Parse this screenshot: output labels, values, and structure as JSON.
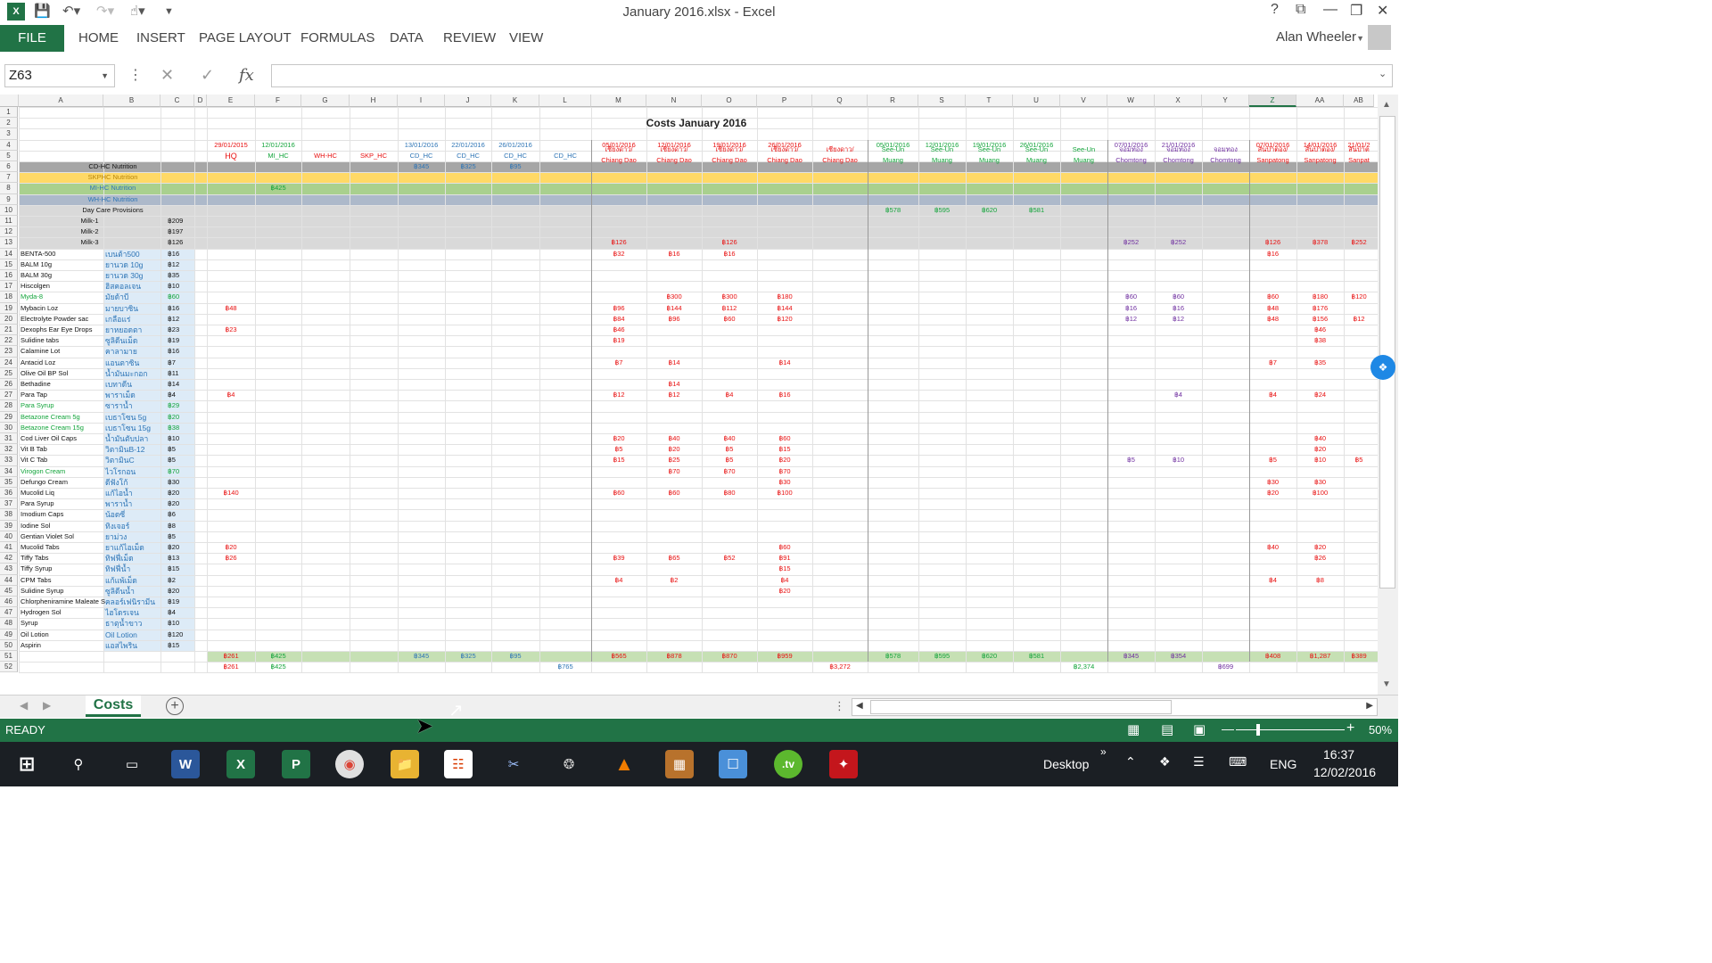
{
  "window": {
    "title": "January 2016.xlsx - Excel"
  },
  "ribbon": {
    "file": "FILE",
    "tabs": [
      "HOME",
      "INSERT",
      "PAGE LAYOUT",
      "FORMULAS",
      "DATA",
      "REVIEW",
      "VIEW"
    ],
    "user": "Alan Wheeler"
  },
  "formula_bar": {
    "name_box": "Z63",
    "fx": "fx",
    "value": ""
  },
  "columns": [
    "A",
    "B",
    "C",
    "D",
    "E",
    "F",
    "G",
    "H",
    "I",
    "J",
    "K",
    "L",
    "M",
    "N",
    "O",
    "P",
    "Q",
    "R",
    "S",
    "T",
    "U",
    "V",
    "W",
    "X",
    "Y",
    "Z",
    "AA",
    "AB"
  ],
  "sheet": {
    "title": "Costs January 2016",
    "header_dates": [
      "29/01/2015",
      "12/01/2016",
      "",
      "",
      "13/01/2016",
      "22/01/2016",
      "26/01/2016",
      "",
      "05/01/2016",
      "12/01/2016",
      "19/01/2016",
      "26/01/2016",
      "",
      "05/01/2016",
      "12/01/2016",
      "19/01/2016",
      "26/01/2016",
      "",
      "07/01/2016",
      "21/01/2016",
      "",
      "07/01/2016",
      "14/01/2016",
      "21/01/2"
    ],
    "header_loc1": [
      "HQ",
      "MI_HC",
      "WH-HC",
      "SKP_HC",
      "CD_HC",
      "CD_HC",
      "CD_HC",
      "CD_HC",
      "เชียงดาว/",
      "เชียงดาว/",
      "เชียงดาว/",
      "เชียงดาว/",
      "เชียงดาว/",
      "See-Un",
      "See-Un",
      "See-Un",
      "See-Un",
      "See-Un",
      "จอมทอง",
      "จอมทอง",
      "จอมทอง",
      "สันป่าตอง/",
      "สันป่าตอง/",
      "สันป่าต"
    ],
    "header_loc2": [
      "",
      "",
      "",
      "",
      "",
      "",
      "",
      "",
      "Chiang Dao",
      "Chiang Dao",
      "Chiang Dao",
      "Chiang Dao",
      "Chiang Dao",
      "Muang",
      "Muang",
      "Muang",
      "Muang",
      "Muang",
      "Chomtong",
      "Chomtong",
      "Chomtong",
      "Sanpatong",
      "Sanpatong",
      "Sanpat"
    ],
    "band_rows": [
      {
        "row": 6,
        "label": "CD-HC Nutrition"
      },
      {
        "row": 7,
        "label": "SKPHC Nutrition"
      },
      {
        "row": 8,
        "label": "MI-HC Nutrition"
      },
      {
        "row": 9,
        "label": "WH-HC Nutrition"
      },
      {
        "row": 10,
        "label": "Day Care Provisions"
      }
    ],
    "milk_rows": [
      {
        "row": 11,
        "label": "Milk-1",
        "price": "฿209"
      },
      {
        "row": 12,
        "label": "Milk-2",
        "price": "฿197"
      },
      {
        "row": 13,
        "label": "Milk-3",
        "price": "฿126"
      }
    ],
    "items": [
      {
        "en": "BENTA-500",
        "th": "เบนต้า500",
        "p": "฿16"
      },
      {
        "en": "BALM 10g",
        "th": "ยานวด 10g",
        "p": "฿12"
      },
      {
        "en": "BALM 30g",
        "th": "ยานวด 30g",
        "p": "฿35"
      },
      {
        "en": "Hiscolgen",
        "th": "ฮิสคอลเจน",
        "p": "฿10"
      },
      {
        "en": "Myda-8",
        "th": "มัยด้าบี",
        "p": "฿60"
      },
      {
        "en": "Mybacin Loz",
        "th": "มายบาซิน",
        "p": "฿16"
      },
      {
        "en": "Electrolyte Powder sac",
        "th": "เกลือแร่",
        "p": "฿12"
      },
      {
        "en": "Dexophs Ear Eye Drops",
        "th": "ยาหยอดตา",
        "p": "฿23"
      },
      {
        "en": "Sulidine tabs",
        "th": "ซูลิดีนเม็ด",
        "p": "฿19"
      },
      {
        "en": "Calamine Lot",
        "th": "คาลามาย",
        "p": "฿16"
      },
      {
        "en": "Antacid Loz",
        "th": "แอนตาซิน",
        "p": "฿7"
      },
      {
        "en": "Olive Oil BP Sol",
        "th": "น้ำมันมะกอก",
        "p": "฿11"
      },
      {
        "en": "Bethadine",
        "th": "เบทาดีน",
        "p": "฿14"
      },
      {
        "en": "Para Tap",
        "th": "พาราเม็ด",
        "p": "฿4"
      },
      {
        "en": "Para Syrup",
        "th": "ซาราน้ำ",
        "p": "฿29"
      },
      {
        "en": "Betazone Cream 5g",
        "th": "เบธาโซน 5g",
        "p": "฿20"
      },
      {
        "en": "Betazone Cream 15g",
        "th": "เบธาโซน 15g",
        "p": "฿38"
      },
      {
        "en": "Cod Liver Oil Caps",
        "th": "น้ำมันตับปลา",
        "p": "฿10"
      },
      {
        "en": "Vit B Tab",
        "th": "วิตามินB-12",
        "p": "฿5"
      },
      {
        "en": "Vit C Tab",
        "th": "วิตามินC",
        "p": "฿5"
      },
      {
        "en": "Virogon Cream",
        "th": "ไวโรกอน",
        "p": "฿70"
      },
      {
        "en": "Defungo Cream",
        "th": "ดีฟังโก้",
        "p": "฿30"
      },
      {
        "en": "Mucolid Liq",
        "th": "แก้ไอน้ำ",
        "p": "฿20"
      },
      {
        "en": "Para Syrup",
        "th": "พาราน้ำ",
        "p": "฿20"
      },
      {
        "en": "Imodium Caps",
        "th": "น้อดซี่",
        "p": "฿6"
      },
      {
        "en": "Iodine Sol",
        "th": "ทิงเจอร์",
        "p": "฿8"
      },
      {
        "en": "Gentian Violet Sol",
        "th": "ยาม่วง",
        "p": "฿5"
      },
      {
        "en": "Mucolid Tabs",
        "th": "ยาแก้ไอเม็ด",
        "p": "฿20"
      },
      {
        "en": "Tiffy Tabs",
        "th": "ทิฟฟี่เม็ด",
        "p": "฿13"
      },
      {
        "en": "Tiffy Syrup",
        "th": "ทิฟฟี่น้ำ",
        "p": "฿15"
      },
      {
        "en": "CPM Tabs",
        "th": "แก้แพ้เม็ด",
        "p": "฿2"
      },
      {
        "en": "Sulidine Syrup",
        "th": "ซูลิดีนน้ำ",
        "p": "฿20"
      },
      {
        "en": "Chlorpheniramine Maleate S",
        "th": "คลอร์เฟนิรามีน",
        "p": "฿19"
      },
      {
        "en": "Hydrogen Sol",
        "th": "ไฮโดรเจน",
        "p": "฿4"
      },
      {
        "en": "Syrup",
        "th": "ธาตุน้ำขาว",
        "p": "฿10"
      },
      {
        "en": "Oil Lotion",
        "th": "Oil Lotion",
        "p": "฿120"
      },
      {
        "en": "Aspirin",
        "th": "แอสไพริน",
        "p": "฿15"
      }
    ],
    "values": [
      {
        "r": 6,
        "c": "I",
        "v": "฿345",
        "k": "b"
      },
      {
        "r": 6,
        "c": "J",
        "v": "฿325",
        "k": "b"
      },
      {
        "r": 6,
        "c": "K",
        "v": "฿95",
        "k": "b"
      },
      {
        "r": 8,
        "c": "F",
        "v": "฿425",
        "k": "g"
      },
      {
        "r": 10,
        "c": "R",
        "v": "฿578",
        "k": "g"
      },
      {
        "r": 10,
        "c": "S",
        "v": "฿595",
        "k": "g"
      },
      {
        "r": 10,
        "c": "T",
        "v": "฿620",
        "k": "g"
      },
      {
        "r": 10,
        "c": "U",
        "v": "฿581",
        "k": "g"
      },
      {
        "r": 13,
        "c": "M",
        "v": "฿126",
        "k": "r"
      },
      {
        "r": 13,
        "c": "O",
        "v": "฿126",
        "k": "r"
      },
      {
        "r": 13,
        "c": "W",
        "v": "฿252",
        "k": "p"
      },
      {
        "r": 13,
        "c": "X",
        "v": "฿252",
        "k": "p"
      },
      {
        "r": 13,
        "c": "Z",
        "v": "฿126",
        "k": "r"
      },
      {
        "r": 13,
        "c": "AA",
        "v": "฿378",
        "k": "r"
      },
      {
        "r": 13,
        "c": "AB",
        "v": "฿252",
        "k": "r"
      },
      {
        "r": 14,
        "c": "M",
        "v": "฿32",
        "k": "r"
      },
      {
        "r": 14,
        "c": "N",
        "v": "฿16",
        "k": "r"
      },
      {
        "r": 14,
        "c": "O",
        "v": "฿16",
        "k": "r"
      },
      {
        "r": 14,
        "c": "Z",
        "v": "฿16",
        "k": "r"
      },
      {
        "r": 18,
        "c": "N",
        "v": "฿300",
        "k": "r"
      },
      {
        "r": 18,
        "c": "O",
        "v": "฿300",
        "k": "r"
      },
      {
        "r": 18,
        "c": "P",
        "v": "฿180",
        "k": "r"
      },
      {
        "r": 18,
        "c": "W",
        "v": "฿60",
        "k": "p"
      },
      {
        "r": 18,
        "c": "X",
        "v": "฿60",
        "k": "p"
      },
      {
        "r": 18,
        "c": "Z",
        "v": "฿60",
        "k": "r"
      },
      {
        "r": 18,
        "c": "AA",
        "v": "฿180",
        "k": "r"
      },
      {
        "r": 18,
        "c": "AB",
        "v": "฿120",
        "k": "r"
      },
      {
        "r": 19,
        "c": "E",
        "v": "฿48",
        "k": "r"
      },
      {
        "r": 19,
        "c": "M",
        "v": "฿96",
        "k": "r"
      },
      {
        "r": 19,
        "c": "N",
        "v": "฿144",
        "k": "r"
      },
      {
        "r": 19,
        "c": "O",
        "v": "฿112",
        "k": "r"
      },
      {
        "r": 19,
        "c": "P",
        "v": "฿144",
        "k": "r"
      },
      {
        "r": 19,
        "c": "W",
        "v": "฿16",
        "k": "p"
      },
      {
        "r": 19,
        "c": "X",
        "v": "฿16",
        "k": "p"
      },
      {
        "r": 19,
        "c": "Z",
        "v": "฿48",
        "k": "r"
      },
      {
        "r": 19,
        "c": "AA",
        "v": "฿176",
        "k": "r"
      },
      {
        "r": 20,
        "c": "M",
        "v": "฿84",
        "k": "r"
      },
      {
        "r": 20,
        "c": "N",
        "v": "฿96",
        "k": "r"
      },
      {
        "r": 20,
        "c": "O",
        "v": "฿60",
        "k": "r"
      },
      {
        "r": 20,
        "c": "P",
        "v": "฿120",
        "k": "r"
      },
      {
        "r": 20,
        "c": "W",
        "v": "฿12",
        "k": "p"
      },
      {
        "r": 20,
        "c": "X",
        "v": "฿12",
        "k": "p"
      },
      {
        "r": 20,
        "c": "Z",
        "v": "฿48",
        "k": "r"
      },
      {
        "r": 20,
        "c": "AA",
        "v": "฿156",
        "k": "r"
      },
      {
        "r": 20,
        "c": "AB",
        "v": "฿12",
        "k": "r"
      },
      {
        "r": 21,
        "c": "E",
        "v": "฿23",
        "k": "r"
      },
      {
        "r": 21,
        "c": "M",
        "v": "฿46",
        "k": "r"
      },
      {
        "r": 21,
        "c": "AA",
        "v": "฿46",
        "k": "r"
      },
      {
        "r": 22,
        "c": "M",
        "v": "฿19",
        "k": "r"
      },
      {
        "r": 22,
        "c": "AA",
        "v": "฿38",
        "k": "r"
      },
      {
        "r": 24,
        "c": "M",
        "v": "฿7",
        "k": "r"
      },
      {
        "r": 24,
        "c": "N",
        "v": "฿14",
        "k": "r"
      },
      {
        "r": 24,
        "c": "P",
        "v": "฿14",
        "k": "r"
      },
      {
        "r": 24,
        "c": "Z",
        "v": "฿7",
        "k": "r"
      },
      {
        "r": 24,
        "c": "AA",
        "v": "฿35",
        "k": "r"
      },
      {
        "r": 26,
        "c": "N",
        "v": "฿14",
        "k": "r"
      },
      {
        "r": 27,
        "c": "E",
        "v": "฿4",
        "k": "r"
      },
      {
        "r": 27,
        "c": "M",
        "v": "฿12",
        "k": "r"
      },
      {
        "r": 27,
        "c": "N",
        "v": "฿12",
        "k": "r"
      },
      {
        "r": 27,
        "c": "O",
        "v": "฿4",
        "k": "r"
      },
      {
        "r": 27,
        "c": "P",
        "v": "฿16",
        "k": "r"
      },
      {
        "r": 27,
        "c": "X",
        "v": "฿4",
        "k": "p"
      },
      {
        "r": 27,
        "c": "Z",
        "v": "฿4",
        "k": "r"
      },
      {
        "r": 27,
        "c": "AA",
        "v": "฿24",
        "k": "r"
      },
      {
        "r": 31,
        "c": "M",
        "v": "฿20",
        "k": "r"
      },
      {
        "r": 31,
        "c": "N",
        "v": "฿40",
        "k": "r"
      },
      {
        "r": 31,
        "c": "O",
        "v": "฿40",
        "k": "r"
      },
      {
        "r": 31,
        "c": "P",
        "v": "฿60",
        "k": "r"
      },
      {
        "r": 31,
        "c": "AA",
        "v": "฿40",
        "k": "r"
      },
      {
        "r": 32,
        "c": "M",
        "v": "฿5",
        "k": "r"
      },
      {
        "r": 32,
        "c": "N",
        "v": "฿20",
        "k": "r"
      },
      {
        "r": 32,
        "c": "O",
        "v": "฿5",
        "k": "r"
      },
      {
        "r": 32,
        "c": "P",
        "v": "฿15",
        "k": "r"
      },
      {
        "r": 32,
        "c": "AA",
        "v": "฿20",
        "k": "r"
      },
      {
        "r": 33,
        "c": "M",
        "v": "฿15",
        "k": "r"
      },
      {
        "r": 33,
        "c": "N",
        "v": "฿25",
        "k": "r"
      },
      {
        "r": 33,
        "c": "O",
        "v": "฿5",
        "k": "r"
      },
      {
        "r": 33,
        "c": "P",
        "v": "฿20",
        "k": "r"
      },
      {
        "r": 33,
        "c": "W",
        "v": "฿5",
        "k": "p"
      },
      {
        "r": 33,
        "c": "X",
        "v": "฿10",
        "k": "p"
      },
      {
        "r": 33,
        "c": "Z",
        "v": "฿5",
        "k": "r"
      },
      {
        "r": 33,
        "c": "AA",
        "v": "฿10",
        "k": "r"
      },
      {
        "r": 33,
        "c": "AB",
        "v": "฿5",
        "k": "r"
      },
      {
        "r": 34,
        "c": "N",
        "v": "฿70",
        "k": "r"
      },
      {
        "r": 34,
        "c": "O",
        "v": "฿70",
        "k": "r"
      },
      {
        "r": 34,
        "c": "P",
        "v": "฿70",
        "k": "r"
      },
      {
        "r": 35,
        "c": "P",
        "v": "฿30",
        "k": "r"
      },
      {
        "r": 35,
        "c": "Z",
        "v": "฿30",
        "k": "r"
      },
      {
        "r": 35,
        "c": "AA",
        "v": "฿30",
        "k": "r"
      },
      {
        "r": 36,
        "c": "E",
        "v": "฿140",
        "k": "r"
      },
      {
        "r": 36,
        "c": "M",
        "v": "฿60",
        "k": "r"
      },
      {
        "r": 36,
        "c": "N",
        "v": "฿60",
        "k": "r"
      },
      {
        "r": 36,
        "c": "O",
        "v": "฿80",
        "k": "r"
      },
      {
        "r": 36,
        "c": "P",
        "v": "฿100",
        "k": "r"
      },
      {
        "r": 36,
        "c": "Z",
        "v": "฿20",
        "k": "r"
      },
      {
        "r": 36,
        "c": "AA",
        "v": "฿100",
        "k": "r"
      },
      {
        "r": 41,
        "c": "E",
        "v": "฿20",
        "k": "r"
      },
      {
        "r": 41,
        "c": "P",
        "v": "฿60",
        "k": "r"
      },
      {
        "r": 41,
        "c": "Z",
        "v": "฿40",
        "k": "r"
      },
      {
        "r": 41,
        "c": "AA",
        "v": "฿20",
        "k": "r"
      },
      {
        "r": 42,
        "c": "E",
        "v": "฿26",
        "k": "r"
      },
      {
        "r": 42,
        "c": "M",
        "v": "฿39",
        "k": "r"
      },
      {
        "r": 42,
        "c": "N",
        "v": "฿65",
        "k": "r"
      },
      {
        "r": 42,
        "c": "O",
        "v": "฿52",
        "k": "r"
      },
      {
        "r": 42,
        "c": "P",
        "v": "฿91",
        "k": "r"
      },
      {
        "r": 42,
        "c": "AA",
        "v": "฿26",
        "k": "r"
      },
      {
        "r": 43,
        "c": "P",
        "v": "฿15",
        "k": "r"
      },
      {
        "r": 44,
        "c": "M",
        "v": "฿4",
        "k": "r"
      },
      {
        "r": 44,
        "c": "N",
        "v": "฿2",
        "k": "r"
      },
      {
        "r": 44,
        "c": "P",
        "v": "฿4",
        "k": "r"
      },
      {
        "r": 44,
        "c": "Z",
        "v": "฿4",
        "k": "r"
      },
      {
        "r": 44,
        "c": "AA",
        "v": "฿8",
        "k": "r"
      },
      {
        "r": 45,
        "c": "P",
        "v": "฿20",
        "k": "r"
      },
      {
        "r": 51,
        "c": "E",
        "v": "฿261",
        "k": "r"
      },
      {
        "r": 51,
        "c": "F",
        "v": "฿425",
        "k": "g"
      },
      {
        "r": 51,
        "c": "I",
        "v": "฿345",
        "k": "b"
      },
      {
        "r": 51,
        "c": "J",
        "v": "฿325",
        "k": "b"
      },
      {
        "r": 51,
        "c": "K",
        "v": "฿95",
        "k": "b"
      },
      {
        "r": 51,
        "c": "M",
        "v": "฿565",
        "k": "r"
      },
      {
        "r": 51,
        "c": "N",
        "v": "฿878",
        "k": "r"
      },
      {
        "r": 51,
        "c": "O",
        "v": "฿870",
        "k": "r"
      },
      {
        "r": 51,
        "c": "P",
        "v": "฿959",
        "k": "r"
      },
      {
        "r": 51,
        "c": "R",
        "v": "฿578",
        "k": "g"
      },
      {
        "r": 51,
        "c": "S",
        "v": "฿595",
        "k": "g"
      },
      {
        "r": 51,
        "c": "T",
        "v": "฿620",
        "k": "g"
      },
      {
        "r": 51,
        "c": "U",
        "v": "฿581",
        "k": "g"
      },
      {
        "r": 51,
        "c": "W",
        "v": "฿345",
        "k": "p"
      },
      {
        "r": 51,
        "c": "X",
        "v": "฿354",
        "k": "p"
      },
      {
        "r": 51,
        "c": "Z",
        "v": "฿408",
        "k": "r"
      },
      {
        "r": 51,
        "c": "AA",
        "v": "฿1,287",
        "k": "r"
      },
      {
        "r": 51,
        "c": "AB",
        "v": "฿389",
        "k": "r"
      },
      {
        "r": 52,
        "c": "E",
        "v": "฿261",
        "k": "r"
      },
      {
        "r": 52,
        "c": "F",
        "v": "฿425",
        "k": "g"
      },
      {
        "r": 52,
        "c": "L",
        "v": "฿765",
        "k": "b"
      },
      {
        "r": 52,
        "c": "Q",
        "v": "฿3,272",
        "k": "r"
      },
      {
        "r": 52,
        "c": "V",
        "v": "฿2,374",
        "k": "g"
      },
      {
        "r": 52,
        "c": "Y",
        "v": "฿699",
        "k": "p"
      }
    ],
    "colors": {
      "r": "#e81010",
      "g": "#12a43a",
      "b": "#2e75b6",
      "p": "#7030a0",
      "band_cd": "#a6a6a6",
      "band_skp": "#ffd966",
      "band_mi": "#a9d08e",
      "band_wh": "#adb9ca",
      "band_day": "#d9d9d9",
      "thai_bg": "#ddebf7",
      "total_bg": "#c6e0b4"
    }
  },
  "sheet_tabs": {
    "active": "Costs"
  },
  "status": {
    "ready": "READY",
    "zoom": "50%"
  },
  "taskbar": {
    "desktop": "Desktop",
    "lang": "ENG",
    "time": "16:37",
    "date": "12/02/2016"
  }
}
